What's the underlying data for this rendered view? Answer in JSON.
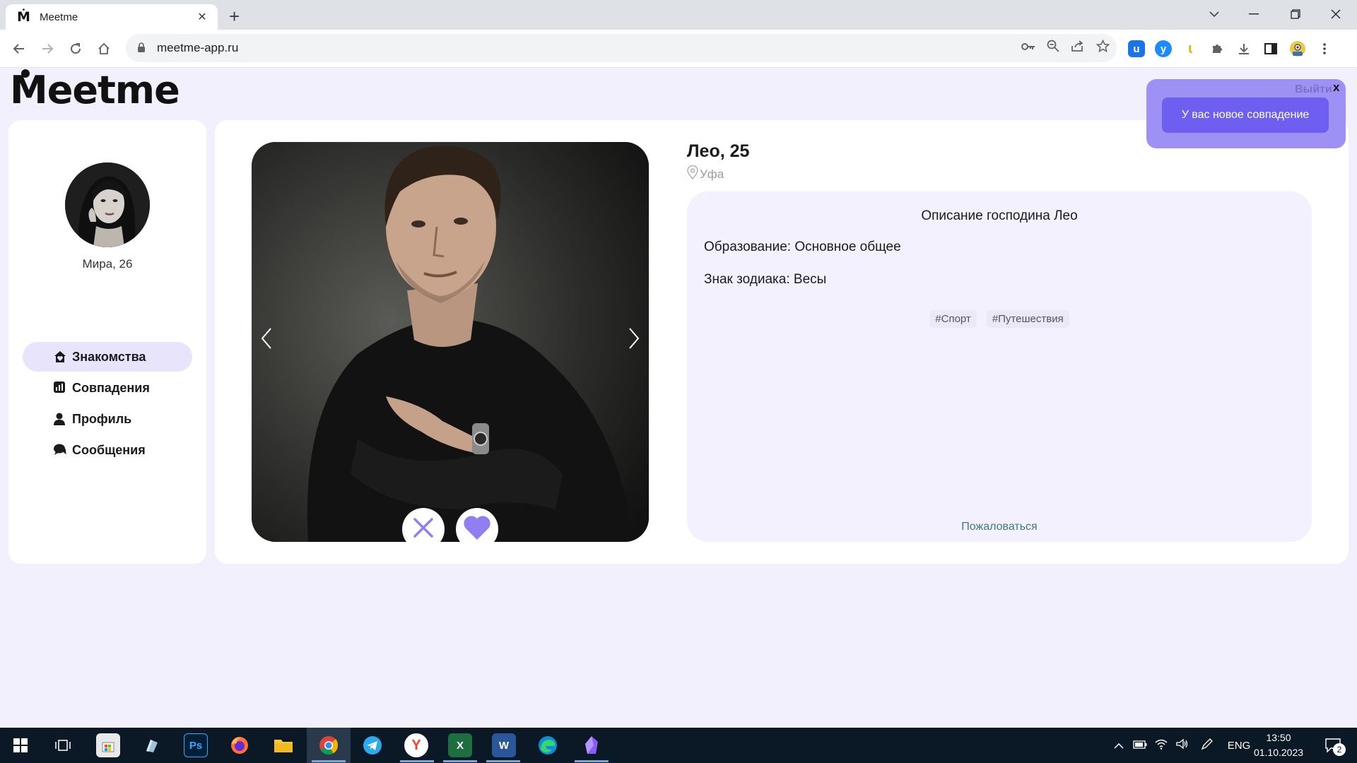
{
  "browser": {
    "tab_title": "Meetme",
    "tab_favicon": "Ṁ",
    "new_tab_glyph": "+",
    "url": "meetme-app.ru",
    "extensions": [
      {
        "name": "extension-u-icon",
        "glyph": "u",
        "color": "#1a73e8"
      },
      {
        "name": "extension-y-icon",
        "glyph": "ў",
        "color": "#1a8cff"
      },
      {
        "name": "extension-yellow-icon",
        "glyph": "l",
        "color": "#f5c400"
      }
    ]
  },
  "app": {
    "logo": "Meetme",
    "user": {
      "name": "Мира, 26"
    },
    "menu": [
      {
        "label": "Знакомства",
        "icon": "home-heart-icon",
        "active": true
      },
      {
        "label": "Совпадения",
        "icon": "chart-icon",
        "active": false
      },
      {
        "label": "Профиль",
        "icon": "person-icon",
        "active": false
      },
      {
        "label": "Сообщения",
        "icon": "chat-icon",
        "active": false
      }
    ],
    "profile": {
      "name": "Лео, 25",
      "city": "Уфа",
      "description_title": "Описание господина Лео",
      "education": "Образование: Основное общее",
      "zodiac": "Знак зодиака: Весы",
      "tags": [
        "#Спорт",
        "#Путешествия"
      ],
      "report_label": "Пожаловаться"
    },
    "toast": {
      "logout_label": "Выйти",
      "close_label": "x",
      "message": "У вас новое совпадение"
    },
    "colors": {
      "accent": "#8f7ff2",
      "page_bg": "#f2f0fd",
      "toast_bg": "#9d91f5",
      "toast_button": "#6f5ff0"
    }
  },
  "taskbar": {
    "lang": "ENG",
    "time": "13:50",
    "date": "01.10.2023",
    "notifications": "2",
    "apps": [
      {
        "name": "start-icon"
      },
      {
        "name": "task-view-icon"
      },
      {
        "name": "store-icon"
      },
      {
        "name": "paint-icon"
      },
      {
        "name": "photoshop-icon",
        "glyph": "Ps"
      },
      {
        "name": "firefox-icon"
      },
      {
        "name": "file-explorer-icon"
      },
      {
        "name": "chrome-icon"
      },
      {
        "name": "telegram-icon"
      },
      {
        "name": "yandex-browser-icon",
        "glyph": "Y"
      },
      {
        "name": "excel-icon",
        "glyph": "X"
      },
      {
        "name": "word-icon",
        "glyph": "W"
      },
      {
        "name": "edge-icon"
      },
      {
        "name": "obsidian-icon"
      }
    ]
  }
}
